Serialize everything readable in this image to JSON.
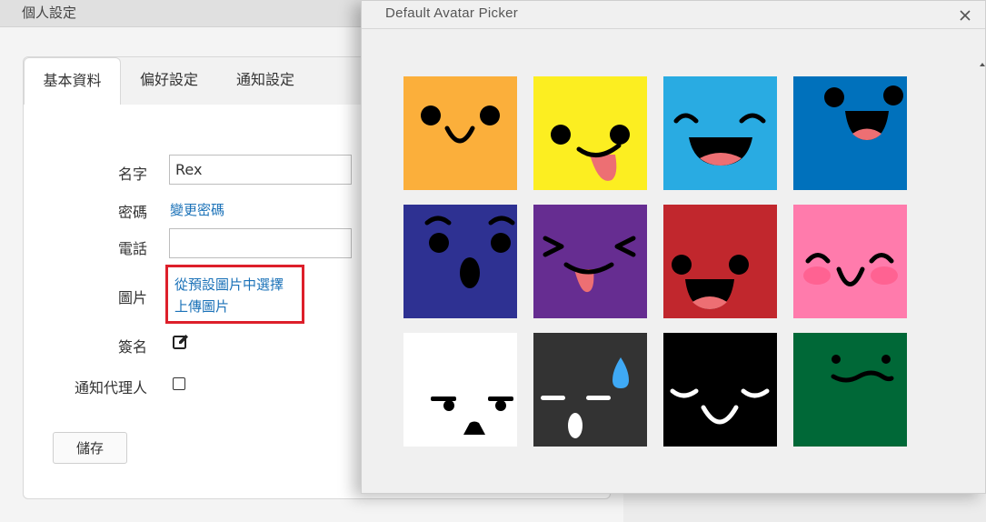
{
  "settings": {
    "window_title": "個人設定",
    "tabs": [
      {
        "label": "基本資料"
      },
      {
        "label": "偏好設定"
      },
      {
        "label": "通知設定"
      }
    ],
    "form": {
      "name_label": "名字",
      "name_value": "Rex",
      "password_label": "密碼",
      "change_password_link": "變更密碼",
      "phone_label": "電話",
      "phone_value": "",
      "picture_label": "圖片",
      "choose_default_link": "從預設圖片中選擇",
      "upload_link": "上傳圖片",
      "signature_label": "簽名",
      "signature_icon": "edit-icon",
      "notify_agent_label": "通知代理人",
      "notify_agent_checked": false
    },
    "save_label": "儲存"
  },
  "dialog": {
    "title": "Default Avatar Picker",
    "close_icon": "close-icon",
    "avatars": [
      {
        "face": "smile",
        "color": "#FBAF3B"
      },
      {
        "face": "tongue",
        "color": "#FCEE21"
      },
      {
        "face": "laugh-closed-eyes",
        "color": "#29ABE2"
      },
      {
        "face": "laugh",
        "color": "#0071BC"
      },
      {
        "face": "surprised",
        "color": "#2E3192"
      },
      {
        "face": "squint-tongue",
        "color": "#662D91"
      },
      {
        "face": "laugh-small",
        "color": "#C1272D"
      },
      {
        "face": "blush",
        "color": "#FF7BAC"
      },
      {
        "face": "annoyed",
        "color": "#FFFFFF"
      },
      {
        "face": "sweat",
        "color": "#333333"
      },
      {
        "face": "content-closed-eyes",
        "color": "#000000"
      },
      {
        "face": "uneasy",
        "color": "#006837"
      }
    ]
  }
}
